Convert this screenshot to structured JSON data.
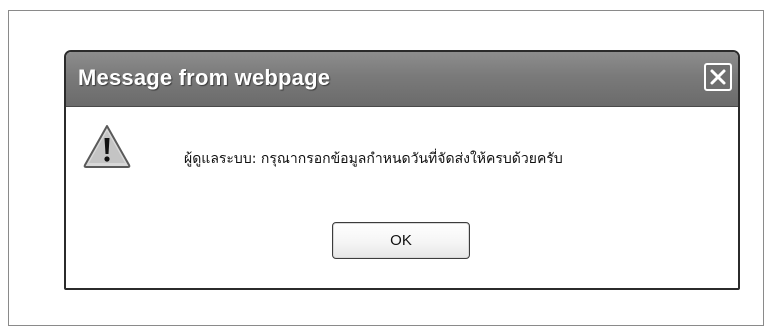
{
  "dialog": {
    "title": "Message from webpage",
    "close_icon": "close-icon",
    "warning_icon": "warning-icon",
    "message": "ผู้ดูแลระบบ: กรุณากรอกข้อมูลกำหนดวันที่จัดส่งให้ครบด้วยครับ",
    "ok_label": "OK"
  },
  "colors": {
    "titlebar": "#7a7a7a",
    "title_text": "#ffffff",
    "body": "#ffffff",
    "border": "#2b2b2b"
  }
}
